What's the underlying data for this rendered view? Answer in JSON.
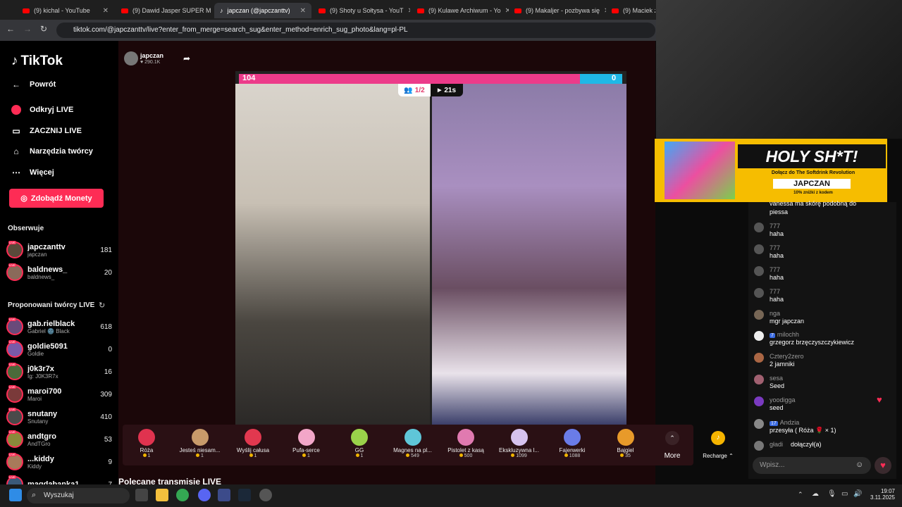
{
  "browser": {
    "tabs": [
      {
        "label": "(9) kichal - YouTube"
      },
      {
        "label": "(9) Dawid Jasper SUPER M"
      },
      {
        "label": "japczan (@japczanttv)"
      },
      {
        "label": "(9) Shoty u Sołtysa - YouT"
      },
      {
        "label": "(9) Kulawe Archiwum - Yo"
      },
      {
        "label": "(9) Makaljer - pozbywa się"
      },
      {
        "label": "(9) Maciek z Ca"
      }
    ],
    "url": "tiktok.com/@japczanttv/live?enter_from_merge=search_sug&enter_method=enrich_sug_photo&lang=pl-PL"
  },
  "sidebar": {
    "logo": "TikTok",
    "menu": [
      {
        "label": "Powrót"
      },
      {
        "label": "Odkryj LIVE"
      },
      {
        "label": "ZACZNIJ LIVE"
      },
      {
        "label": "Narzędzia twórcy"
      },
      {
        "label": "Więcej"
      }
    ],
    "coins_button": "Zdobądź Monety",
    "following_title": "Obserwuje",
    "following": [
      {
        "name": "japczanttv",
        "sub": "japczan",
        "count": "181"
      },
      {
        "name": "baldnews_",
        "sub": "baldnews_",
        "count": "20"
      }
    ],
    "suggested_title": "Proponowani twórcy LIVE",
    "suggested": [
      {
        "name": "gab.rielblack",
        "sub": "Gabriel 🌚 Black",
        "count": "618"
      },
      {
        "name": "goldie5091",
        "sub": "Goldie",
        "count": "0"
      },
      {
        "name": "j0k3r7x",
        "sub": "Ig: J0K3R7x",
        "count": "16"
      },
      {
        "name": "maroi700",
        "sub": "Maroi",
        "count": "309"
      },
      {
        "name": "snutany",
        "sub": "Snutany",
        "count": "410"
      },
      {
        "name": "andtgro",
        "sub": "AndTGro",
        "count": "53"
      },
      {
        "name": "...kiddy",
        "sub": "Kiddy",
        "count": "9"
      },
      {
        "name": "magdabanka1",
        "sub": "",
        "count": "7"
      }
    ]
  },
  "streamer": {
    "name": "japczan",
    "likes": "290.1K"
  },
  "battle": {
    "left_score": "104",
    "right_score": "0",
    "viewers": "1/2",
    "timer": "21s"
  },
  "gifts": [
    {
      "name": "Róża",
      "price": "1",
      "color": "#e0334f"
    },
    {
      "name": "Jesteś niesam...",
      "price": "1",
      "color": "#c89a6a"
    },
    {
      "name": "Wyślij całusa",
      "price": "1",
      "color": "#e2384f"
    },
    {
      "name": "Pufa-serce",
      "price": "1",
      "color": "#f2a6c8"
    },
    {
      "name": "GG",
      "price": "1",
      "color": "#9ad24a"
    },
    {
      "name": "Magnes na pl...",
      "price": "549",
      "color": "#5fc6d8"
    },
    {
      "name": "Pistolet z kasą",
      "price": "500",
      "color": "#e07ab0"
    },
    {
      "name": "Ekskluzywna l...",
      "price": "1099",
      "color": "#d6c2ee"
    },
    {
      "name": "Fajerwerki",
      "price": "1088",
      "color": "#6a7ce8"
    },
    {
      "name": "Bajgiel",
      "price": "35",
      "color": "#e89a2a"
    }
  ],
  "gift_more": "More",
  "recharge": "Recharge",
  "recommended_title": "Polecane transmisje LIVE",
  "promo": {
    "headline": "HOLY SH*T!",
    "line": "Dołącz do The Softdrink Revolution",
    "name": "JAPCZAN",
    "discount": "10% zniżki z kodem"
  },
  "chat": {
    "messages": [
      {
        "user": "",
        "text": "vanessa ma skórę podobną do piessa"
      },
      {
        "user": "777",
        "text": "haha"
      },
      {
        "user": "777",
        "text": "haha"
      },
      {
        "user": "777",
        "text": "haha"
      },
      {
        "user": "777",
        "text": "haha"
      },
      {
        "user": "nga",
        "text": "mgr japczan"
      },
      {
        "user": "milochh",
        "text": "grzegorz brzęczyszczykiewicz",
        "badge": "7"
      },
      {
        "user": "Cztery2zero",
        "text": "2 jamniki"
      },
      {
        "user": "sesa",
        "text": "Seed"
      },
      {
        "user": "yoodigga",
        "text": "seed"
      },
      {
        "user": "Andzia",
        "text": "przesyła ( Róża 🌹 × 1)",
        "badge": "17"
      },
      {
        "user": "gładi",
        "text": "dołączył(a)"
      }
    ],
    "input_placeholder": "Wpisz..."
  },
  "taskbar": {
    "search": "Wyszukaj",
    "time": "19:07",
    "date": "3.11.2025"
  }
}
